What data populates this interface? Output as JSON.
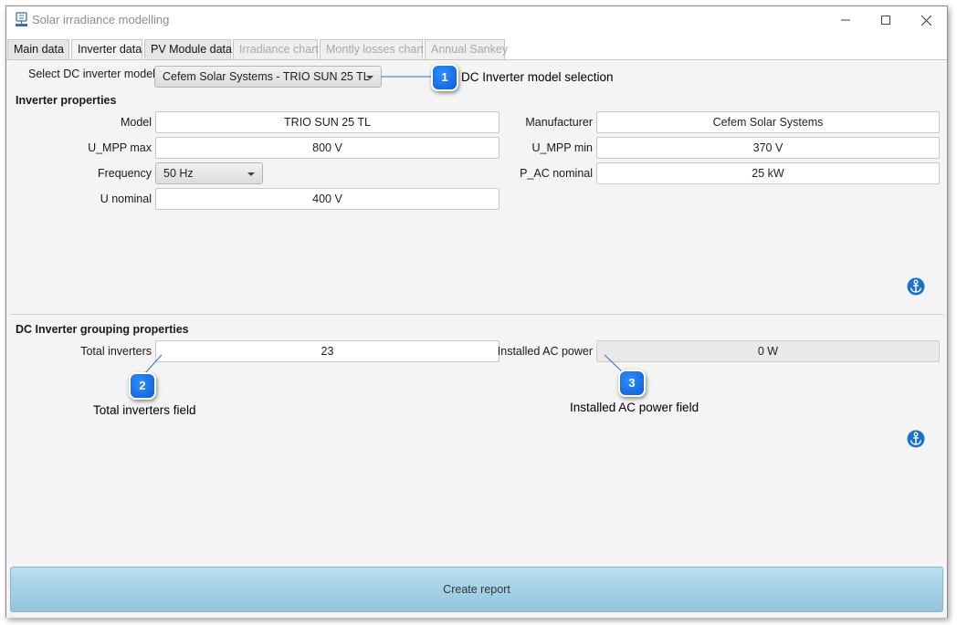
{
  "window": {
    "title": "Solar irradiance modelling",
    "icon": "solar-panel-logo-icon",
    "controls": [
      "minimize-icon",
      "maximize-icon",
      "close-icon"
    ]
  },
  "tabs": [
    {
      "label": "Main data",
      "state": "normal"
    },
    {
      "label": "Inverter data",
      "state": "active"
    },
    {
      "label": "PV Module data",
      "state": "normal"
    },
    {
      "label": "Irradiance chart",
      "state": "disabled"
    },
    {
      "label": "Montly losses chart",
      "state": "disabled"
    },
    {
      "label": "Annual Sankey",
      "state": "disabled"
    }
  ],
  "selector": {
    "label": "Select DC inverter model",
    "value": "Cefem Solar Systems - TRIO SUN 25 TL"
  },
  "inverter_properties": {
    "title": "Inverter properties",
    "model": {
      "label": "Model",
      "value": "TRIO SUN 25 TL"
    },
    "manufacturer": {
      "label": "Manufacturer",
      "value": "Cefem Solar Systems"
    },
    "umpp_max": {
      "label": "U_MPP max",
      "value": "800 V"
    },
    "umpp_min": {
      "label": "U_MPP min",
      "value": "370 V"
    },
    "frequency": {
      "label": "Frequency",
      "value": "50 Hz"
    },
    "pac_nominal": {
      "label": "P_AC nominal",
      "value": "25 kW"
    },
    "u_nominal": {
      "label": "U nominal",
      "value": "400 V"
    }
  },
  "grouping": {
    "title": "DC Inverter grouping properties",
    "total_inverters": {
      "label": "Total inverters",
      "value": "23"
    },
    "installed_ac": {
      "label": "Installed AC power",
      "value": "0 W"
    }
  },
  "create_report": "Create report",
  "callouts": [
    {
      "number": "1",
      "text": "DC Inverter model selection"
    },
    {
      "number": "2",
      "text": "Total inverters field"
    },
    {
      "number": "3",
      "text": "Installed AC power field"
    }
  ],
  "colors": {
    "accent": "#0a5fd4",
    "button": "#a5d3e6",
    "help_icon": "#1a73c9"
  }
}
